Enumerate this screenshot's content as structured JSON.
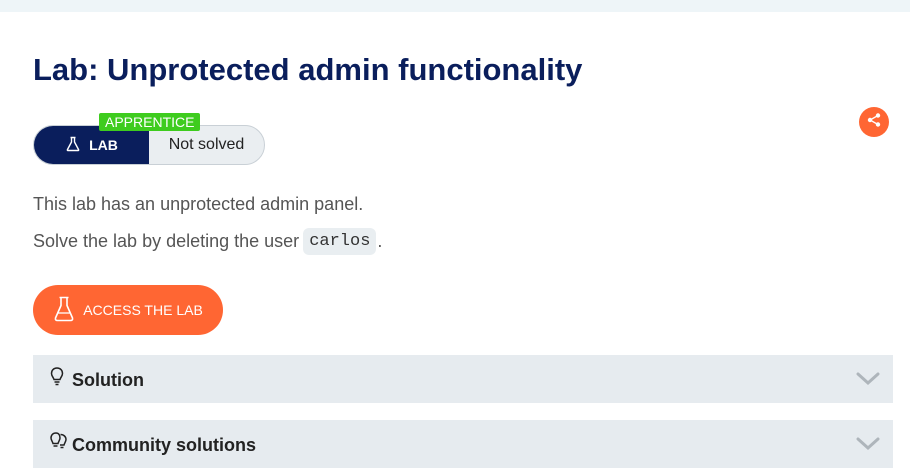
{
  "page": {
    "title": "Lab: Unprotected admin functionality"
  },
  "status": {
    "level": "APPRENTICE",
    "lab_label": "LAB",
    "state": "Not solved"
  },
  "description": {
    "line1": "This lab has an unprotected admin panel.",
    "line2_prefix": "Solve the lab by deleting the user",
    "line2_code": "carlos",
    "line2_suffix": "."
  },
  "actions": {
    "access_lab": "ACCESS THE LAB",
    "share_icon": "share-icon"
  },
  "accordions": [
    {
      "label": "Solution",
      "icon": "lightbulb-icon"
    },
    {
      "label": "Community solutions",
      "icon": "lightbulbs-icon"
    }
  ],
  "colors": {
    "brand_navy": "#0a1e5c",
    "accent_orange": "#ff6633",
    "level_green": "#3ecc1e",
    "panel_gray": "#e6ebef"
  }
}
